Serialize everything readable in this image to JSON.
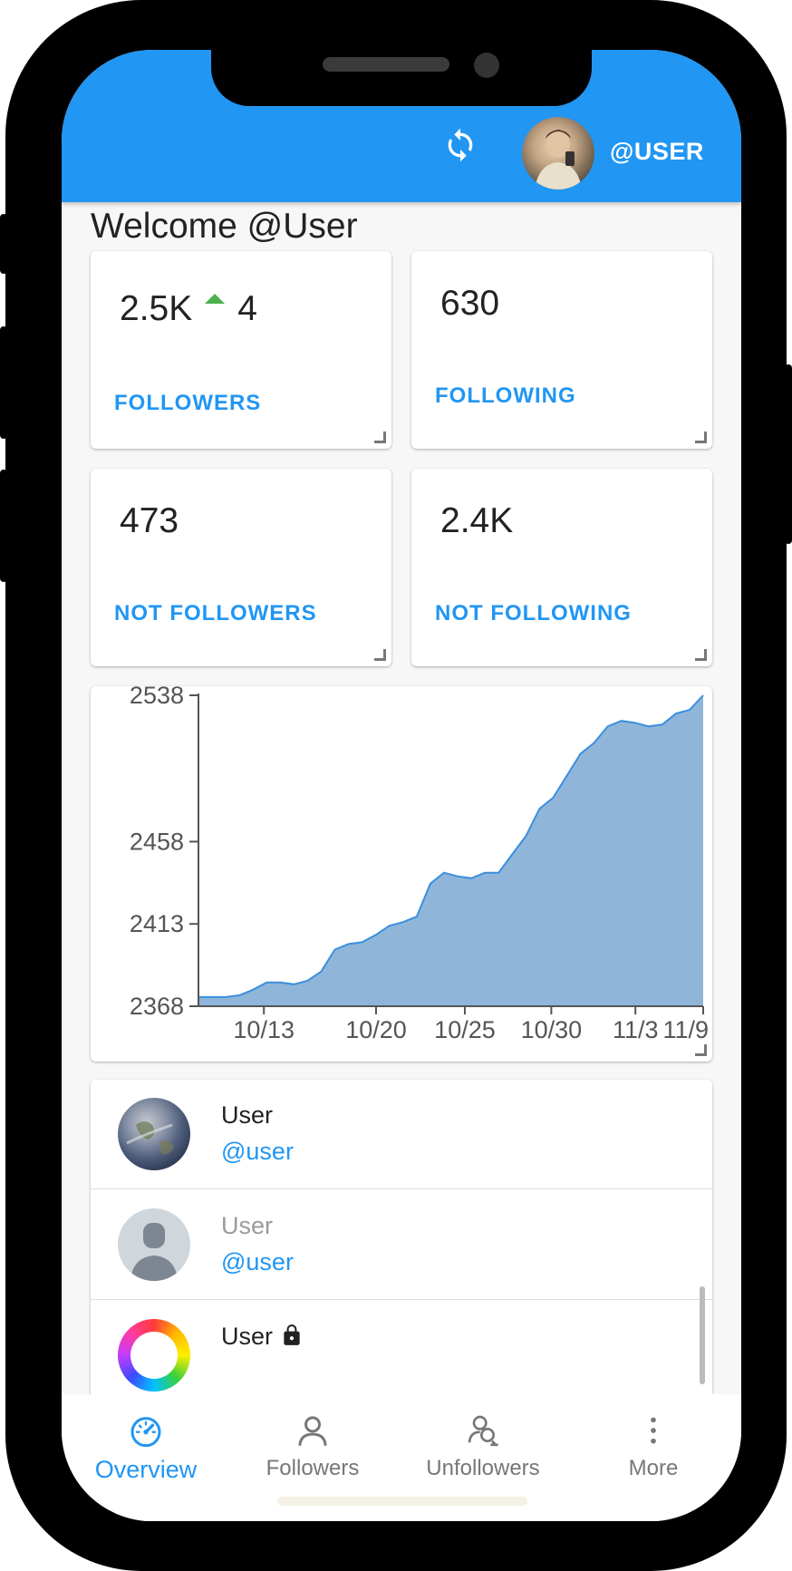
{
  "header": {
    "username": "@USER"
  },
  "welcome": "Welcome @User",
  "stats": {
    "followers": {
      "value": "2.5K",
      "delta": "4",
      "label": "FOLLOWERS"
    },
    "following": {
      "value": "630",
      "label": "FOLLOWING"
    },
    "not_followers": {
      "value": "473",
      "label": "NOT FOLLOWERS"
    },
    "not_following": {
      "value": "2.4K",
      "label": "NOT FOLLOWING"
    }
  },
  "chart_data": {
    "type": "area",
    "yticks": [
      "2538",
      "2458",
      "2413",
      "2368"
    ],
    "xticks": [
      "10/13",
      "10/20",
      "10/25",
      "10/30",
      "11/3",
      "11/9"
    ],
    "ylim": [
      2368,
      2538
    ],
    "series": [
      {
        "color": "#8fb6d9",
        "points": [
          [
            0,
            2373
          ],
          [
            1,
            2373
          ],
          [
            2,
            2373
          ],
          [
            3,
            2374
          ],
          [
            4,
            2377
          ],
          [
            5,
            2381
          ],
          [
            6,
            2381
          ],
          [
            7,
            2380
          ],
          [
            8,
            2382
          ],
          [
            9,
            2387
          ],
          [
            10,
            2399
          ],
          [
            11,
            2402
          ],
          [
            12,
            2403
          ],
          [
            13,
            2407
          ],
          [
            14,
            2412
          ],
          [
            15,
            2414
          ],
          [
            16,
            2417
          ],
          [
            17,
            2435
          ],
          [
            18,
            2441
          ],
          [
            19,
            2439
          ],
          [
            20,
            2438
          ],
          [
            21,
            2441
          ],
          [
            22,
            2441
          ],
          [
            23,
            2451
          ],
          [
            24,
            2461
          ],
          [
            25,
            2476
          ],
          [
            26,
            2482
          ],
          [
            27,
            2494
          ],
          [
            28,
            2506
          ],
          [
            29,
            2512
          ],
          [
            30,
            2521
          ],
          [
            31,
            2524
          ],
          [
            32,
            2523
          ],
          [
            33,
            2521
          ],
          [
            34,
            2522
          ],
          [
            35,
            2528
          ],
          [
            36,
            2530
          ],
          [
            37,
            2538
          ]
        ]
      }
    ]
  },
  "list": [
    {
      "name": "User",
      "handle": "@user",
      "muted": false,
      "locked": false,
      "avatar": "earth"
    },
    {
      "name": "User",
      "handle": "@user",
      "muted": true,
      "locked": false,
      "avatar": "default-person"
    },
    {
      "name": "User",
      "handle": "",
      "muted": false,
      "locked": true,
      "avatar": "rainbow"
    }
  ],
  "nav": [
    {
      "label": "Overview",
      "icon": "speedometer-icon",
      "active": true
    },
    {
      "label": "Followers",
      "icon": "person-icon",
      "active": false
    },
    {
      "label": "Unfollowers",
      "icon": "person-minus-icon",
      "active": false
    },
    {
      "label": "More",
      "icon": "more-vert-icon",
      "active": false
    }
  ],
  "colors": {
    "primary": "#2196f3",
    "up": "#4caf50",
    "area": "#8fb6d9",
    "line": "#3b8ede"
  }
}
